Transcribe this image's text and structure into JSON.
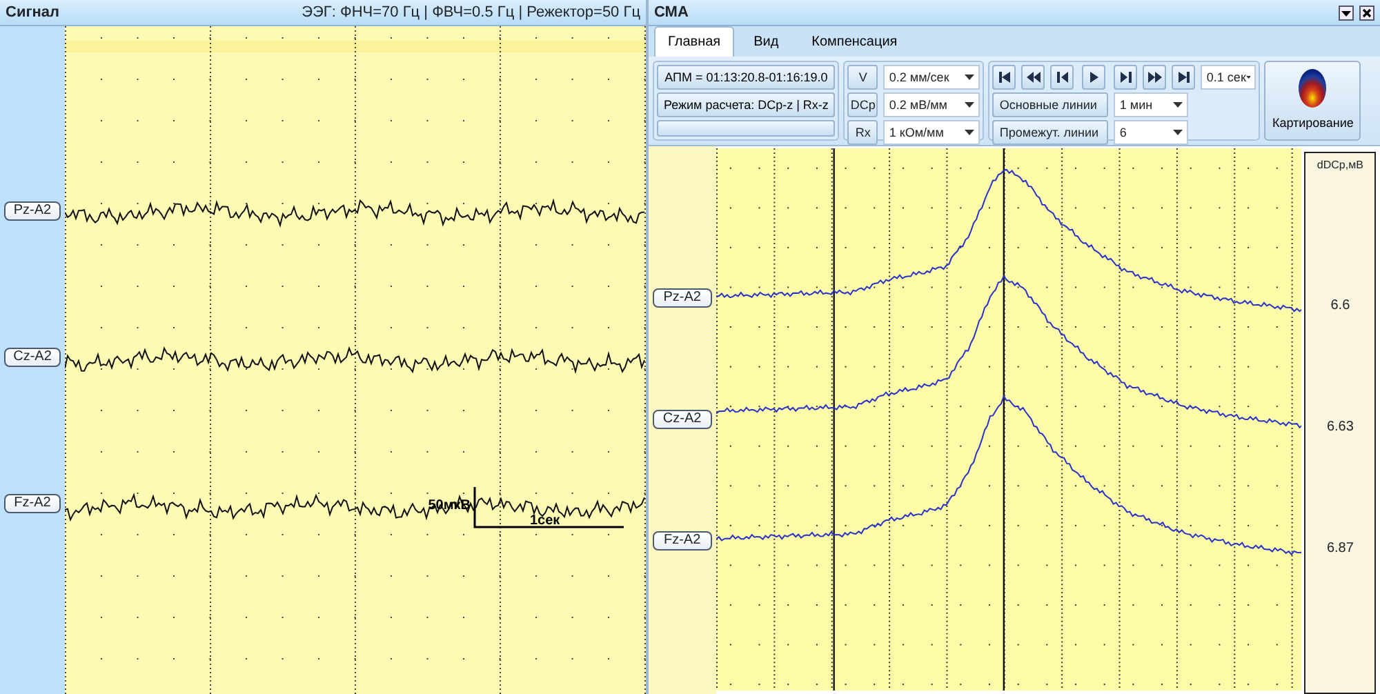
{
  "signal_panel": {
    "title": "Сигнал",
    "filter_info": "ЭЭГ: ФНЧ=70 Гц | ФВЧ=0.5 Гц | Режектор=50 Гц",
    "channels": [
      {
        "label": "Pz-A2"
      },
      {
        "label": "Cz-A2"
      },
      {
        "label": "Fz-A2"
      }
    ],
    "scale": {
      "amplitude": "50мкВ",
      "time": "1сек"
    }
  },
  "sma_panel": {
    "title": "СМА",
    "tabs": [
      {
        "label": "Главная",
        "selected": true
      },
      {
        "label": "Вид",
        "selected": false
      },
      {
        "label": "Компенсация",
        "selected": false
      }
    ],
    "ribbon": {
      "apm": "АПМ = 01:13:20.8-01:16:19.0",
      "mode": "Режим расчета: DCp-z | Rx-z",
      "params": [
        {
          "label": "V",
          "value": "0.2 мм/сек"
        },
        {
          "label": "DCp",
          "value": "0.2 мВ/мм"
        },
        {
          "label": "Rx",
          "value": "1 кОм/мм"
        }
      ],
      "step": "0.1 сек",
      "lines": [
        {
          "label": "Основные линии",
          "value": "1 мин"
        },
        {
          "label": "Промежут. линии",
          "value": "6"
        }
      ],
      "mapping": "Картирование"
    },
    "value_header": "dDCp,мВ",
    "channels": [
      {
        "label": "Pz-A2",
        "value": "6.6"
      },
      {
        "label": "Cz-A2",
        "value": "6.63"
      },
      {
        "label": "Fz-A2",
        "value": "6.87"
      }
    ]
  }
}
